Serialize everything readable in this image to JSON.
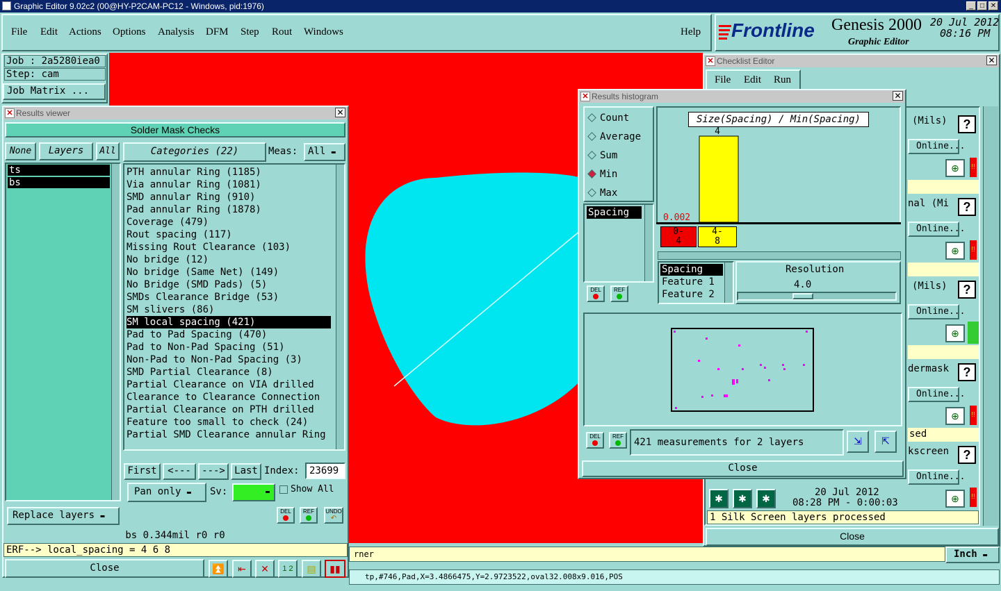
{
  "window_title": "Graphic Editor 9.02c2 (00@HY-P2CAM-PC12 - Windows, pid:1976)",
  "menu": [
    "File",
    "Edit",
    "Actions",
    "Options",
    "Analysis",
    "DFM",
    "Step",
    "Rout",
    "Windows"
  ],
  "help_label": "Help",
  "brand": {
    "logo": "Frontline",
    "product": "Genesis 2000",
    "subtitle": "Graphic Editor",
    "date": "20 Jul 2012",
    "time": "08:16 PM"
  },
  "job_panel": {
    "job": "Job : 2a5280iea0",
    "step": "Step: cam",
    "matrix_btn": "Job Matrix ..."
  },
  "results_viewer": {
    "title": "Results viewer",
    "header": "Solder Mask Checks",
    "none_btn": "None",
    "layers_btn": "Layers",
    "all_btn": "All",
    "layers": [
      "ts",
      "bs"
    ],
    "categories_label": "Categories (22)",
    "meas_label": "Meas:",
    "meas_value": "All",
    "categories": [
      "PTH annular Ring (1185)",
      "Via annular Ring (1081)",
      "SMD annular Ring (910)",
      "Pad annular Ring (1878)",
      "Coverage (479)",
      "Rout spacing (117)",
      "Missing Rout Clearance (103)",
      "No bridge (12)",
      "No bridge (Same Net) (149)",
      "No Bridge (SMD Pads) (5)",
      "SMDs Clearance Bridge (53)",
      "SM slivers (86)",
      "SM local spacing (421)",
      "Pad to Pad Spacing (470)",
      "Pad to Non-Pad Spacing (51)",
      "Non-Pad to Non-Pad Spacing (3)",
      "SMD Partial Clearance (8)",
      "Partial Clearance on VIA drilled",
      "Clearance to Clearance Connection",
      "Partial Clearance on PTH drilled",
      "Feature too small to check (24)",
      "Partial SMD Clearance annular Ring"
    ],
    "selected_category": "SM local spacing (421)",
    "nav": {
      "first": "First",
      "prev": "<---",
      "next": "--->",
      "last": "Last",
      "index_label": "Index:",
      "index_value": "23699"
    },
    "pan_only": "Pan only",
    "sv_label": "Sv:",
    "show_all": "Show All",
    "replace_layers": "Replace layers",
    "status": "bs 0.344mil  r0  r0",
    "erf": "ERF--> local_spacing = 4 6 8",
    "close": "Close",
    "del": "DEL",
    "ref": "REF",
    "undo": "UNDO"
  },
  "histogram": {
    "title": "Results histogram",
    "options": [
      "Count",
      "Average",
      "Sum",
      "Min",
      "Max"
    ],
    "selected_option": "Min",
    "chart_title": "Size(Spacing) / Min(Spacing)",
    "bar_value": "4",
    "min_value": "0.002",
    "bins": [
      {
        "label_top": "0-",
        "label_bottom": "4",
        "count": 0
      },
      {
        "label_top": "4-",
        "label_bottom": "8",
        "count": 4
      }
    ],
    "list1": [
      "Spacing"
    ],
    "list2": [
      "Spacing",
      "Feature 1",
      "Feature 2"
    ],
    "resolution_label": "Resolution",
    "resolution_value": "4.0",
    "summary": "421 measurements for 2 layers",
    "close": "Close",
    "del": "DEL",
    "ref": "REF"
  },
  "checklist": {
    "title": "Checklist Editor",
    "menu": [
      "File",
      "Edit",
      "Run"
    ],
    "rows": [
      {
        "label": "(Mils)",
        "status_color": "#e00"
      },
      {
        "label": "nal (Mi",
        "status_color": "#e00"
      },
      {
        "label": "(Mils)",
        "status_color": "#33cc33"
      },
      {
        "label": "dermask",
        "status_color": "#e00",
        "note": "sed"
      },
      {
        "label": "kscreen",
        "status_color": "#e00"
      }
    ],
    "online_label": "Online...",
    "date": "20 Jul 2012",
    "time_line": "08:28 PM - 0:00:03",
    "processed": "1 Silk Screen layers processed",
    "close": "Close"
  },
  "bottom": {
    "status_prefix": "rner",
    "units": "Inch",
    "coords": "tp,#746,Pad,X=3.4866475,Y=2.9723522,oval32.008x9.016,POS"
  },
  "colors": {
    "canvas": "#ff0000",
    "pad": "#00e6f0",
    "panel": "#9fd9d3",
    "bar": "#ffff00"
  }
}
